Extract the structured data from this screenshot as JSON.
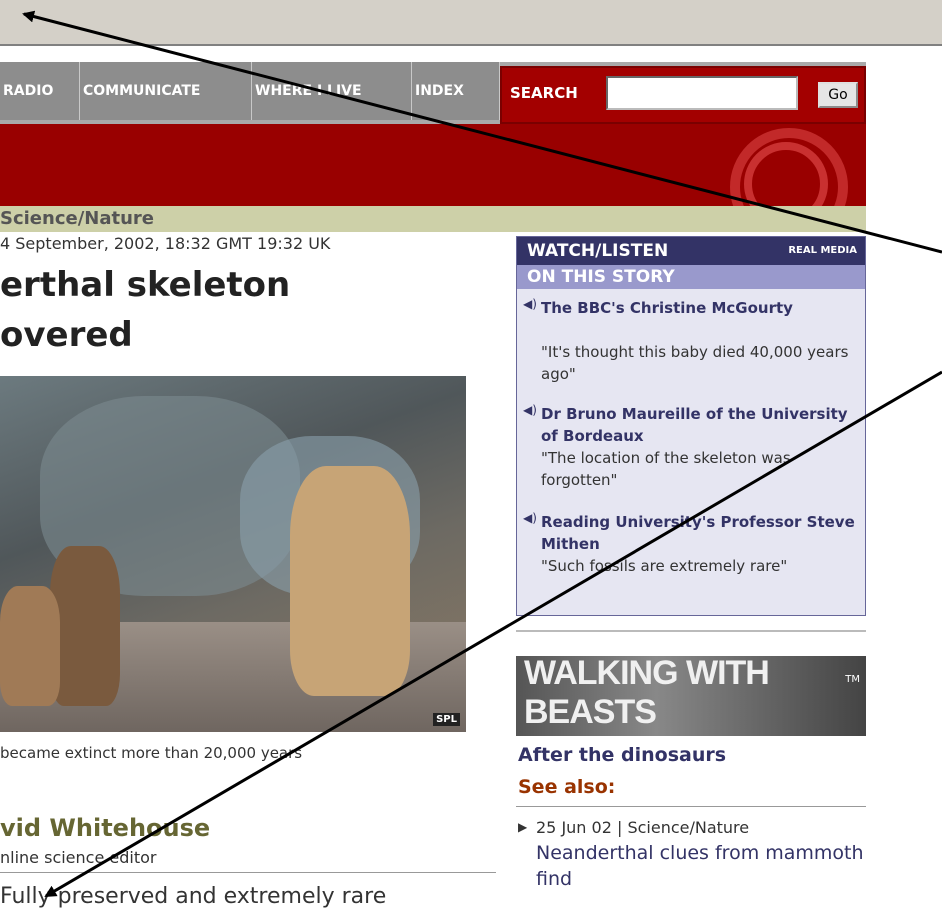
{
  "nav": {
    "items": [
      "RADIO",
      "COMMUNICATE",
      "WHERE I LIVE",
      "INDEX"
    ],
    "search_label": "SEARCH",
    "search_value": "",
    "go_label": "Go"
  },
  "section": "Science/Nature",
  "dateline": "4 September, 2002, 18:32 GMT 19:32 UK",
  "headline_line1": "erthal skeleton",
  "headline_line2": "overed",
  "photo_credit": "SPL",
  "caption": "became extinct more than 20,000 years",
  "byline": "vid Whitehouse",
  "byline_role": "nline science editor",
  "body_text": "Fully preserved and extremely rare",
  "watch": {
    "title": "WATCH/LISTEN",
    "real_media": "REAL MEDIA",
    "subtitle": "ON THIS STORY",
    "items": [
      {
        "title": "The BBC's Christine McGourty",
        "quote": "\"It's thought this baby died 40,000 years ago\""
      },
      {
        "title": "Dr Bruno Maureille of the University of Bordeaux",
        "quote": "\"The location of the skeleton was forgotten\""
      },
      {
        "title": "Reading University's Professor Steve Mithen",
        "quote": "\"Such fossils are extremely rare\""
      }
    ]
  },
  "walking_banner": "WALKING WITH BEASTS",
  "walking_tm": "TM",
  "after_link": "After the dinosaurs",
  "see_also": "See also:",
  "story": {
    "meta": "25 Jun 02 | Science/Nature",
    "title": "Neanderthal clues from mammoth find"
  },
  "colors": {
    "nav_gray": "#8d8d8d",
    "search_red": "#a30000",
    "banner_red": "#990000",
    "section_bar": "#cdd0a8",
    "watch_dark": "#333366",
    "watch_light": "#9999cc",
    "see_also": "#993300"
  },
  "icons": [
    "audio-icon",
    "arrow-bullet-icon",
    "globe-logo-icon"
  ]
}
